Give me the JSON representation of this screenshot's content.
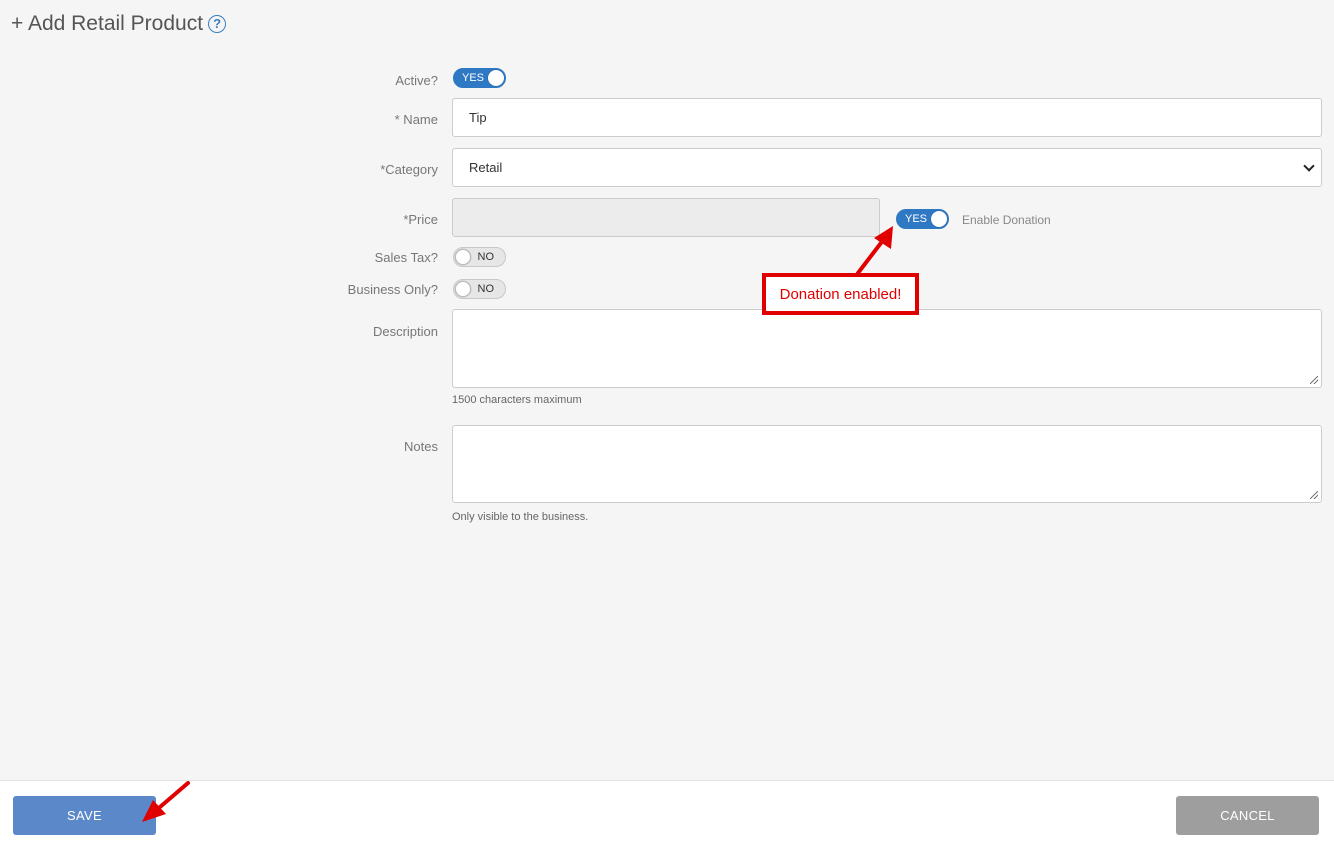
{
  "header": {
    "title": "+ Add Retail Product",
    "help_icon": "?"
  },
  "form": {
    "active": {
      "label": "Active?",
      "state": "YES"
    },
    "name": {
      "label": "* Name",
      "value": "Tip"
    },
    "category": {
      "label": "*Category",
      "value": "Retail"
    },
    "price": {
      "label": "*Price",
      "value": ""
    },
    "donation": {
      "state": "YES",
      "label": "Enable Donation"
    },
    "sales_tax": {
      "label": "Sales Tax?",
      "state": "NO"
    },
    "business_only": {
      "label": "Business Only?",
      "state": "NO"
    },
    "description": {
      "label": "Description",
      "value": "",
      "help": "1500 characters maximum"
    },
    "notes": {
      "label": "Notes",
      "value": "",
      "help": "Only visible to the business."
    }
  },
  "annotation": {
    "callout": "Donation enabled!",
    "color": "#e00000"
  },
  "footer": {
    "save_label": "SAVE",
    "cancel_label": "CANCEL"
  },
  "colors": {
    "toggle_on": "#2f78c4",
    "save": "#5b88c9",
    "cancel": "#9e9e9e"
  }
}
